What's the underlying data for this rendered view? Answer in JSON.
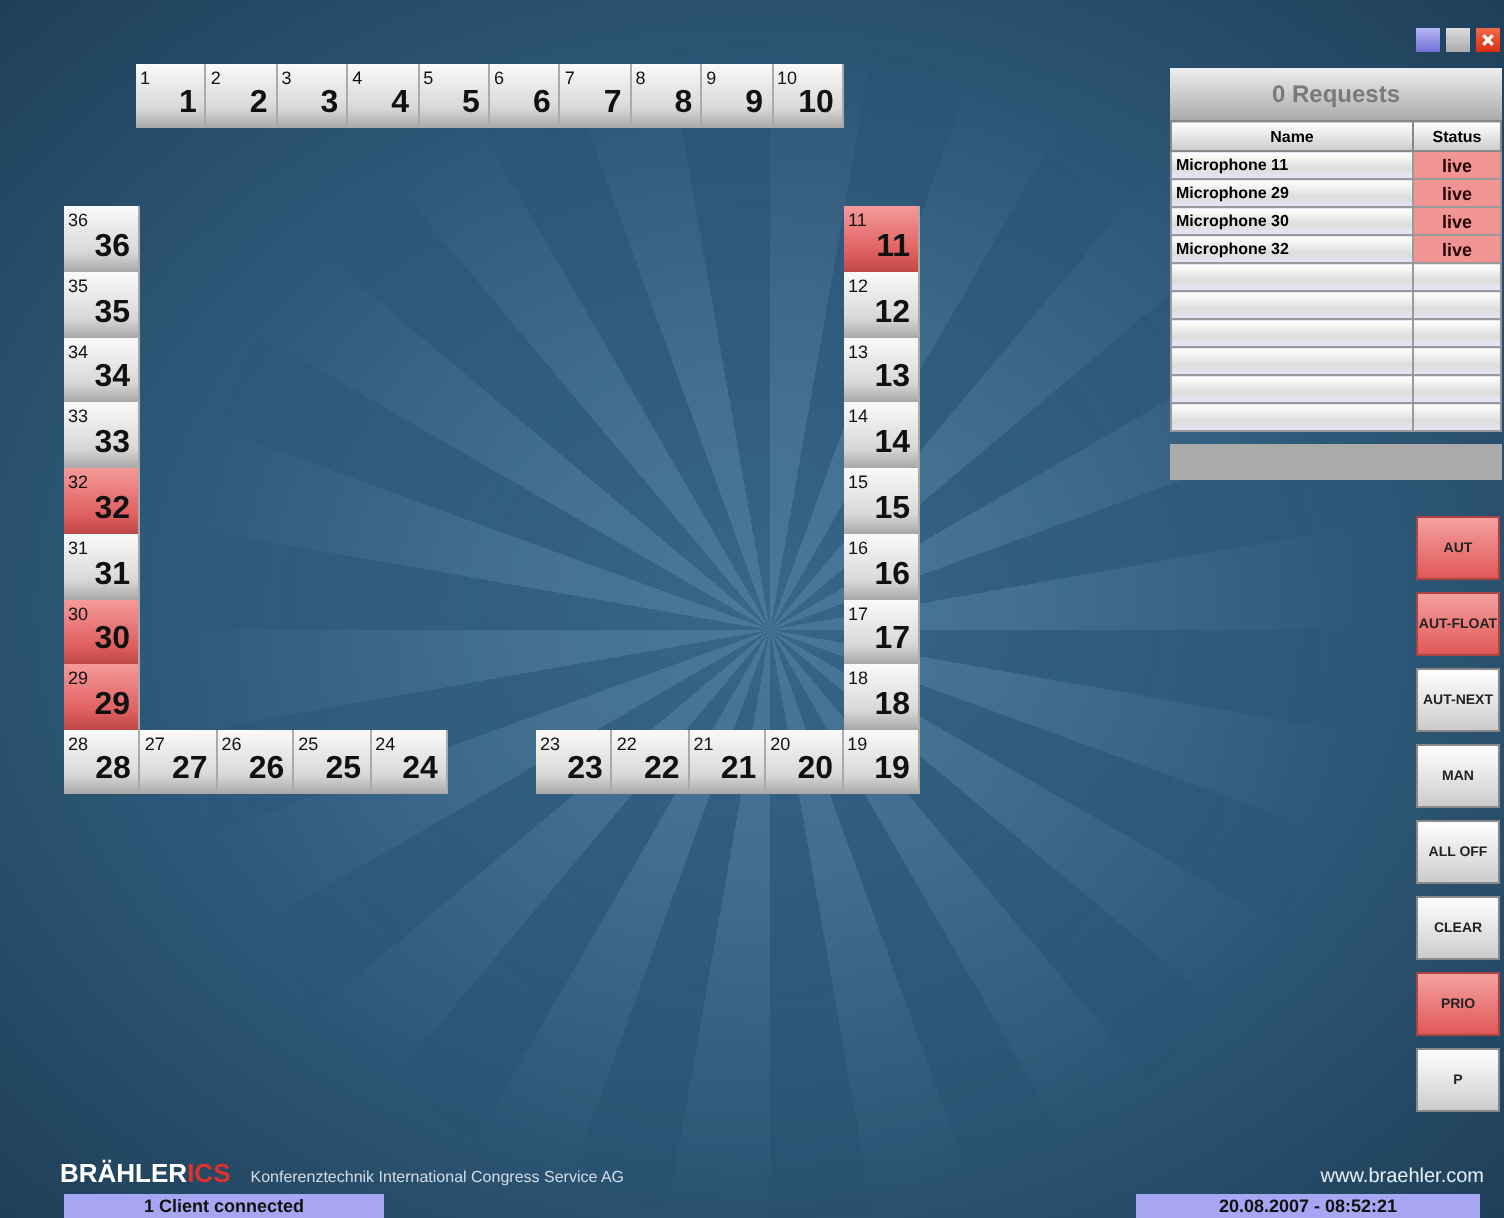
{
  "seat_groups": [
    {
      "kind": "top-row",
      "seats": [
        {
          "badge": "1",
          "label": "1",
          "live": false
        },
        {
          "badge": "2",
          "label": "2",
          "live": false
        },
        {
          "badge": "3",
          "label": "3",
          "live": false
        },
        {
          "badge": "4",
          "label": "4",
          "live": false
        },
        {
          "badge": "5",
          "label": "5",
          "live": false
        },
        {
          "badge": "6",
          "label": "6",
          "live": false
        },
        {
          "badge": "7",
          "label": "7",
          "live": false
        },
        {
          "badge": "8",
          "label": "8",
          "live": false
        },
        {
          "badge": "9",
          "label": "9",
          "live": false
        },
        {
          "badge": "10",
          "label": "10",
          "live": false
        }
      ]
    },
    {
      "kind": "left-column",
      "seats": [
        {
          "badge": "36",
          "label": "36",
          "live": false
        },
        {
          "badge": "35",
          "label": "35",
          "live": false
        },
        {
          "badge": "34",
          "label": "34",
          "live": false
        },
        {
          "badge": "33",
          "label": "33",
          "live": false
        },
        {
          "badge": "32",
          "label": "32",
          "live": true
        },
        {
          "badge": "31",
          "label": "31",
          "live": false
        },
        {
          "badge": "30",
          "label": "30",
          "live": true
        },
        {
          "badge": "29",
          "label": "29",
          "live": true
        }
      ]
    },
    {
      "kind": "right-column",
      "seats": [
        {
          "badge": "11",
          "label": "11",
          "live": true
        },
        {
          "badge": "12",
          "label": "12",
          "live": false
        },
        {
          "badge": "13",
          "label": "13",
          "live": false
        },
        {
          "badge": "14",
          "label": "14",
          "live": false
        },
        {
          "badge": "15",
          "label": "15",
          "live": false
        },
        {
          "badge": "16",
          "label": "16",
          "live": false
        },
        {
          "badge": "17",
          "label": "17",
          "live": false
        },
        {
          "badge": "18",
          "label": "18",
          "live": false
        }
      ]
    },
    {
      "kind": "bottom-left",
      "seats": [
        {
          "badge": "28",
          "label": "28",
          "live": false
        },
        {
          "badge": "27",
          "label": "27",
          "live": false
        },
        {
          "badge": "26",
          "label": "26",
          "live": false
        },
        {
          "badge": "25",
          "label": "25",
          "live": false
        },
        {
          "badge": "24",
          "label": "24",
          "live": false
        }
      ]
    },
    {
      "kind": "bottom-right",
      "seats": [
        {
          "badge": "23",
          "label": "23",
          "live": false
        },
        {
          "badge": "22",
          "label": "22",
          "live": false
        },
        {
          "badge": "21",
          "label": "21",
          "live": false
        },
        {
          "badge": "20",
          "label": "20",
          "live": false
        },
        {
          "badge": "19",
          "label": "19",
          "live": false
        }
      ]
    }
  ],
  "requests": {
    "title": "0 Requests",
    "columns": [
      "Name",
      "Status"
    ],
    "rows": [
      {
        "name": "Microphone 11",
        "status": "live"
      },
      {
        "name": "Microphone 29",
        "status": "live"
      },
      {
        "name": "Microphone 30",
        "status": "live"
      },
      {
        "name": "Microphone 32",
        "status": "live"
      }
    ]
  },
  "modes": [
    {
      "label": "AUT",
      "active": true
    },
    {
      "label": "AUT-FLOAT",
      "active": true
    },
    {
      "label": "AUT-NEXT",
      "active": false
    },
    {
      "label": "MAN",
      "active": false
    },
    {
      "label": "ALL OFF",
      "active": false
    },
    {
      "label": "CLEAR",
      "active": false
    },
    {
      "label": "PRIO",
      "active": true
    },
    {
      "label": "P",
      "active": false
    }
  ],
  "footer": {
    "brand": "BRÄHLER",
    "brand_suffix": "ICS",
    "tagline": "Konferenztechnik International Congress Service AG",
    "url": "www.braehler.com",
    "status_left": "1 Client connected",
    "status_right": "20.08.2007 - 08:52:21"
  }
}
